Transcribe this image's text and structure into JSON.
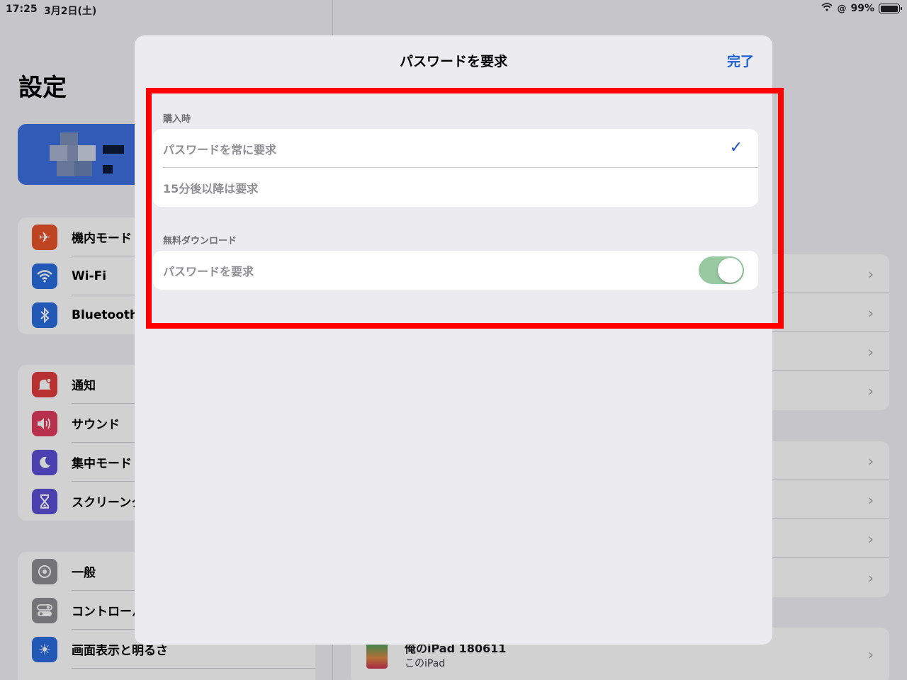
{
  "status_bar": {
    "time": "17:25",
    "date": "3月2日(土)",
    "battery": "99%",
    "battery_level": 0.99
  },
  "sidebar": {
    "title": "設定",
    "groups": [
      {
        "items": [
          {
            "label": "機内モード",
            "icon": "airplane-icon",
            "color": "#e8542a"
          },
          {
            "label": "Wi-Fi",
            "icon": "wifi-icon",
            "color": "#2a6de0"
          },
          {
            "label": "Bluetooth",
            "icon": "bluetooth-icon",
            "color": "#2a6de0"
          }
        ]
      },
      {
        "items": [
          {
            "label": "通知",
            "icon": "bell-icon",
            "color": "#e23b3b"
          },
          {
            "label": "サウンド",
            "icon": "speaker-icon",
            "color": "#e23b5e"
          },
          {
            "label": "集中モード",
            "icon": "moon-icon",
            "color": "#5b4fd6"
          },
          {
            "label": "スクリーンタ",
            "icon": "hourglass-icon",
            "color": "#5b4fd6"
          }
        ]
      },
      {
        "items": [
          {
            "label": "一般",
            "icon": "gear-icon",
            "color": "#8e8e93"
          },
          {
            "label": "コントロール",
            "icon": "switches-icon",
            "color": "#8e8e93"
          },
          {
            "label": "画面表示と明るさ",
            "icon": "sun-icon",
            "color": "#2a6de0"
          }
        ]
      }
    ]
  },
  "detail": {
    "device_name": "俺のiPad 180611",
    "device_sub": "このiPad"
  },
  "modal": {
    "title": "パスワードを要求",
    "done_label": "完了",
    "section_purchase": {
      "header": "購入時",
      "options": [
        {
          "label": "パスワードを常に要求",
          "selected": true
        },
        {
          "label": "15分後以降は要求",
          "selected": false
        }
      ]
    },
    "section_free": {
      "header": "無料ダウンロード",
      "toggle_label": "パスワードを要求",
      "toggle_on": true
    }
  },
  "colors": {
    "accent": "#1a5fd4",
    "highlight": "#ff0000",
    "toggle_on": "#98c9a0"
  }
}
